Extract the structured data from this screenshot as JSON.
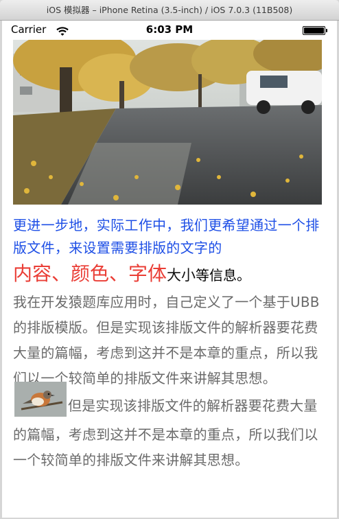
{
  "window": {
    "title": "iOS 模拟器 – iPhone Retina (3.5-inch) / iOS 7.0.3 (11B508)"
  },
  "status_bar": {
    "carrier": "Carrier",
    "time": "6:03 PM"
  },
  "content": {
    "intro": "更进一步地，实际工作中，我们更希望通过一个排版文件，来设置需要排版的文字的",
    "styled_red": "内容、颜色、字体",
    "styled_black": "大小",
    "styled_tail": "等信息。",
    "paragraph_1": "我在开发猿题库应用时，自己定义了一个基于UBB的排版模版。但是实现该排版文件的解析器要花费大量的篇幅，考虑到这并不是本章的重点，所以我们以一个较简单的排版文件来讲解其思想。",
    "paragraph_2": "但是实现该排版文件的解析器要花费大量的篇幅，考虑到这并不是本章的重点，所以我们以一个较简单的排版文件来讲解其思想。"
  },
  "colors": {
    "intro": "#1e4fe6",
    "red": "#ea3d35",
    "body": "#6a6a6a"
  },
  "icons": {
    "wifi": "wifi-icon",
    "battery": "battery-icon"
  }
}
